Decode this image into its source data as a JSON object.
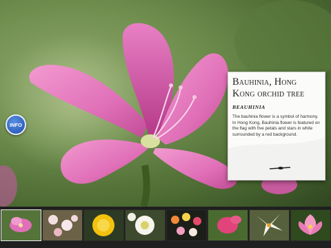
{
  "info_button": {
    "label": "INFO"
  },
  "detail": {
    "title": "Bauhinia, Hong Kong orchid tree",
    "subtitle": "BEAUHINIA",
    "description": "The bauhinia flower is a symbol of harmony. In Hong Kong, Bauhinia flower is featured on the flag with five petals and stars in white surrounded by a red background."
  },
  "thumbnails": [
    {
      "name": "pink-orchid",
      "selected": true
    },
    {
      "name": "white-pink-blossoms",
      "selected": false
    },
    {
      "name": "yellow-chrysanthemum",
      "selected": false
    },
    {
      "name": "white-daisy",
      "selected": false
    },
    {
      "name": "mixed-bouquet",
      "selected": false
    },
    {
      "name": "red-pink-flower",
      "selected": false
    },
    {
      "name": "white-lily",
      "selected": false
    },
    {
      "name": "pink-lotus",
      "selected": false
    }
  ],
  "colors": {
    "petal_pink": "#e070b8",
    "petal_dark": "#b63a8a",
    "info_blue": "#2a62c8",
    "strip": "#1f1f1f"
  }
}
